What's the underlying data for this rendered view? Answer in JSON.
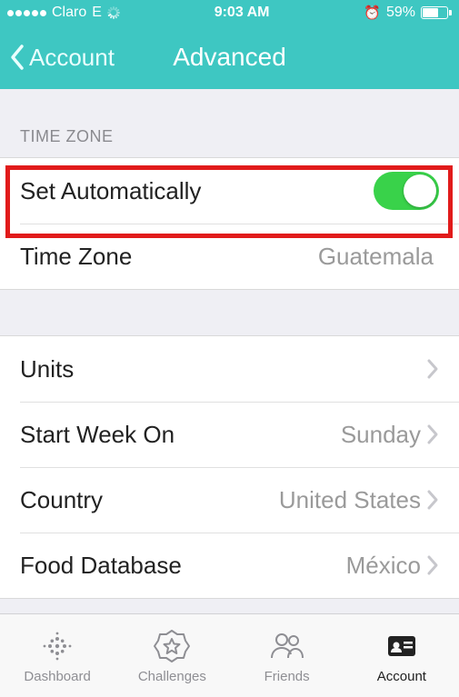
{
  "status": {
    "carrier": "Claro",
    "network": "E",
    "time": "9:03 AM",
    "battery_pct": "59%"
  },
  "nav": {
    "back_label": "Account",
    "title": "Advanced"
  },
  "sections": {
    "timezone_header": "TIME ZONE"
  },
  "timezone": {
    "set_auto_label": "Set Automatically",
    "set_auto_on": true,
    "tz_label": "Time Zone",
    "tz_value": "Guatemala"
  },
  "general": {
    "units_label": "Units",
    "start_week_label": "Start Week On",
    "start_week_value": "Sunday",
    "country_label": "Country",
    "country_value": "United States",
    "food_db_label": "Food Database",
    "food_db_value": "México"
  },
  "tabs": {
    "dashboard": "Dashboard",
    "challenges": "Challenges",
    "friends": "Friends",
    "account": "Account"
  }
}
